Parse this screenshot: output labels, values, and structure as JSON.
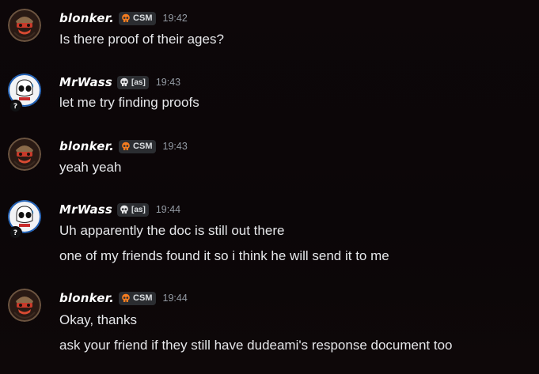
{
  "messages": [
    {
      "username": "blonker.",
      "tag_icon": "orange-skull-icon",
      "tag": "CSM",
      "time": "19:42",
      "avatar": "blonker-avatar",
      "lines": [
        "Is there proof of their ages?"
      ]
    },
    {
      "username": "MrWass",
      "tag_icon": "white-skull-icon",
      "tag": "[as]",
      "time": "19:43",
      "avatar": "mrwass-avatar",
      "badge": "?",
      "lines": [
        "let me try finding proofs"
      ]
    },
    {
      "username": "blonker.",
      "tag_icon": "orange-skull-icon",
      "tag": "CSM",
      "time": "19:43",
      "avatar": "blonker-avatar",
      "lines": [
        "yeah yeah"
      ]
    },
    {
      "username": "MrWass",
      "tag_icon": "white-skull-icon",
      "tag": "[as]",
      "time": "19:44",
      "avatar": "mrwass-avatar",
      "badge": "?",
      "lines": [
        "Uh apparently the doc is still out there",
        "one of my friends found it so i think he will send it to me"
      ]
    },
    {
      "username": "blonker.",
      "tag_icon": "orange-skull-icon",
      "tag": "CSM",
      "time": "19:44",
      "avatar": "blonker-avatar",
      "lines": [
        "Okay, thanks",
        "ask your friend if they still have dudeami's response document too"
      ]
    }
  ],
  "colors": {
    "background": "#0c0709",
    "username": "#ffffff",
    "text": "#e6e7ea",
    "timestamp": "#949ba4",
    "tag_bg": "#2b2d31",
    "skull_orange": "#f57c1f"
  }
}
